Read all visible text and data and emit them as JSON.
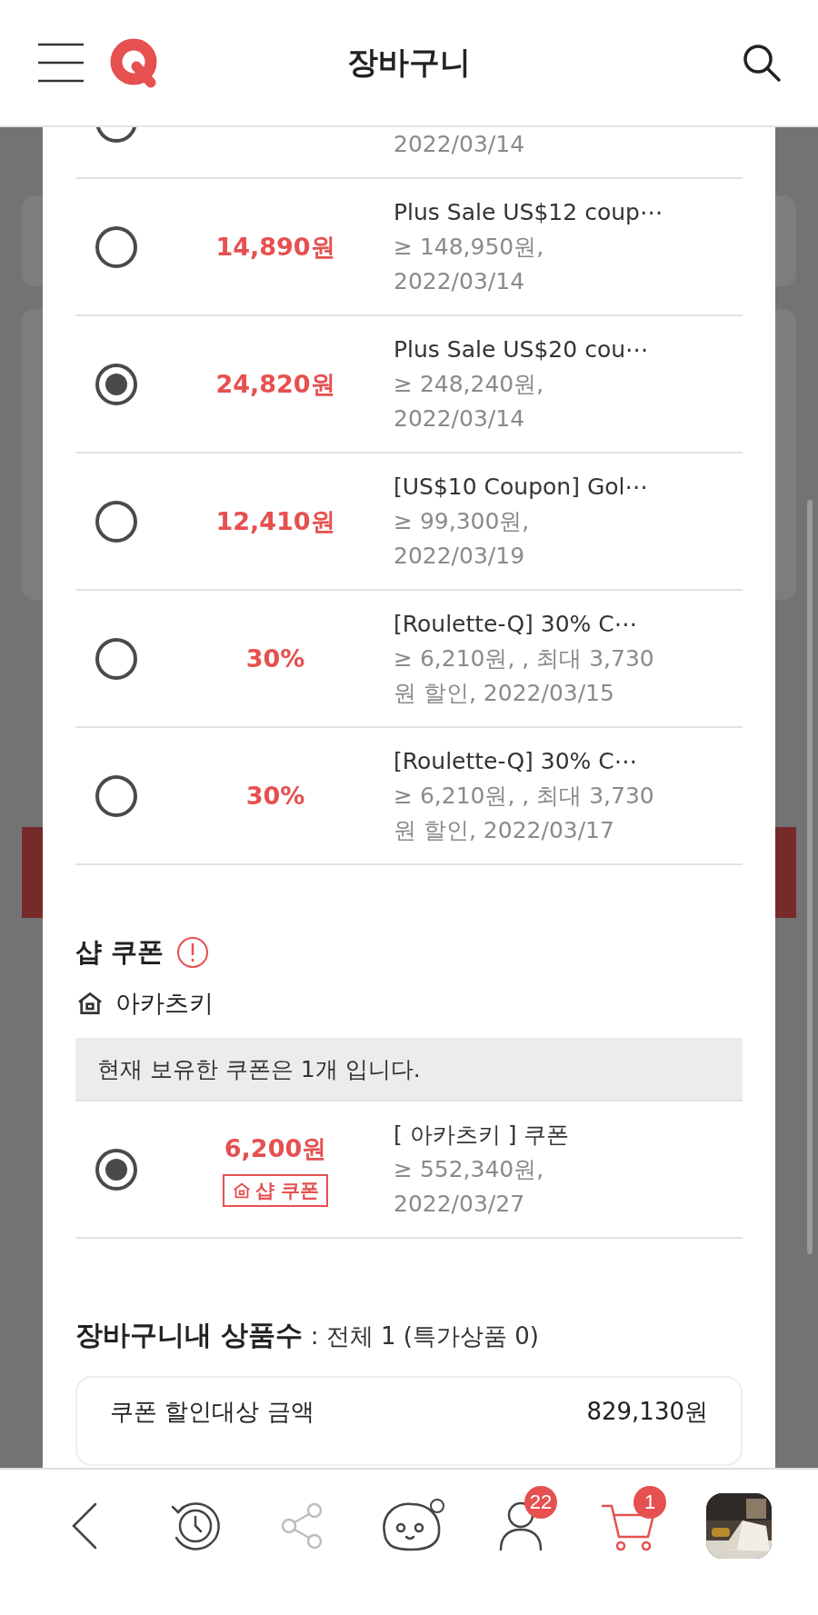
{
  "header": {
    "title": "장바구니"
  },
  "cut_row": {
    "selected": false,
    "details": [
      "2022/03/14"
    ]
  },
  "platform_coupons": [
    {
      "selected": false,
      "amount": "14,890원",
      "name": "Plus Sale US$12 coup⋯",
      "details": [
        "≥ 148,950원,",
        "2022/03/14"
      ]
    },
    {
      "selected": true,
      "amount": "24,820원",
      "name": "Plus Sale US$20 cou⋯",
      "details": [
        "≥ 248,240원,",
        "2022/03/14"
      ]
    },
    {
      "selected": false,
      "amount": "12,410원",
      "name": "[US$10 Coupon] Gol⋯",
      "details": [
        "≥ 99,300원,",
        "2022/03/19"
      ]
    },
    {
      "selected": false,
      "amount": "30%",
      "name": "[Roulette-Q] 30% C⋯",
      "details": [
        "≥ 6,210원, , 최대 3,730",
        "원 할인, 2022/03/15"
      ]
    },
    {
      "selected": false,
      "amount": "30%",
      "name": "[Roulette-Q] 30% C⋯",
      "details": [
        "≥ 6,210원, , 최대 3,730",
        "원 할인, 2022/03/17"
      ]
    }
  ],
  "shop_coupons": {
    "title": "샵 쿠폰",
    "shop": "아카츠키",
    "notice": "현재 보유한 쿠폰은 1개 입니다.",
    "coupons": [
      {
        "selected": true,
        "amount": "6,200원",
        "tag": "샵 쿠폰",
        "name": "[ 아카츠키 ] 쿠폰",
        "details": [
          "≥ 552,340원,",
          "2022/03/27"
        ]
      }
    ]
  },
  "summary": {
    "heading": "**장바구니내 상품수** : 전체 1 (특가상품 0)",
    "rows": [
      {
        "label": "쿠폰 할인대상 금액",
        "value": "829,130원"
      }
    ]
  },
  "bottom_nav": [
    {
      "kind": "back",
      "selected": false,
      "disabled": false
    },
    {
      "kind": "history",
      "selected": false,
      "disabled": false
    },
    {
      "kind": "share",
      "selected": false,
      "disabled": true
    },
    {
      "kind": "mascot",
      "selected": false,
      "disabled": false
    },
    {
      "kind": "profile",
      "selected": false,
      "disabled": false,
      "badge": "22"
    },
    {
      "kind": "cart",
      "selected": true,
      "disabled": false,
      "badge": "1"
    },
    {
      "kind": "thumbnail",
      "selected": false,
      "disabled": false
    }
  ]
}
